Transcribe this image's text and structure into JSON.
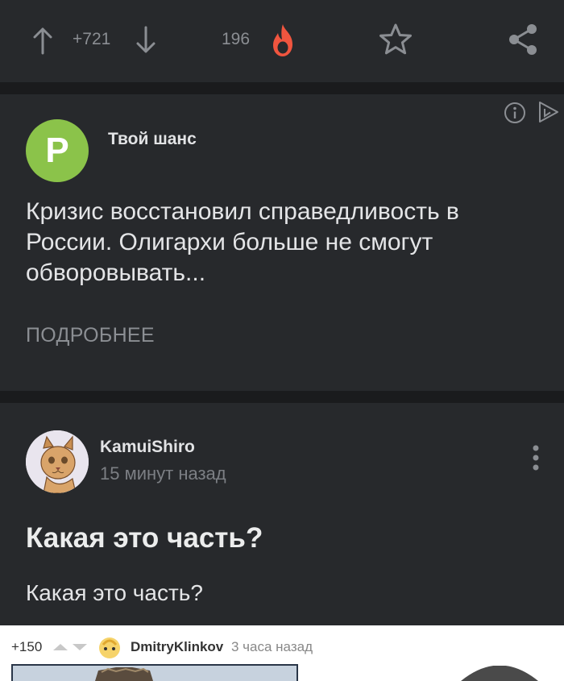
{
  "topbar": {
    "upvote_icon": "arrow-up-icon",
    "rating": "+721",
    "downvote_icon": "arrow-down-icon",
    "hot_count": "196",
    "hot_icon": "fire-icon",
    "save_icon": "star-icon",
    "share_icon": "share-icon"
  },
  "ad": {
    "avatar_letter": "P",
    "avatar_color": "#8bc34a",
    "source": "Твой шанс",
    "text": "Кризис восстановил справедливость в России. Олигархи больше не смогут обворовывать...",
    "more_label": "ПОДРОБНЕЕ",
    "info_icon": "info-icon",
    "adchoices_icon": "adchoices-icon"
  },
  "post": {
    "author": "KamuiShiro",
    "time": "15 минут назад",
    "title": "Какая это часть?",
    "body": "Какая это часть?",
    "menu_icon": "more-vertical-icon"
  },
  "embedded": {
    "score": "+150",
    "author": "DmitryKlinkov",
    "time": "3 часа назад"
  },
  "colors": {
    "background": "#1a1b1d",
    "panel": "#27292c",
    "fire": "#f0553f"
  }
}
